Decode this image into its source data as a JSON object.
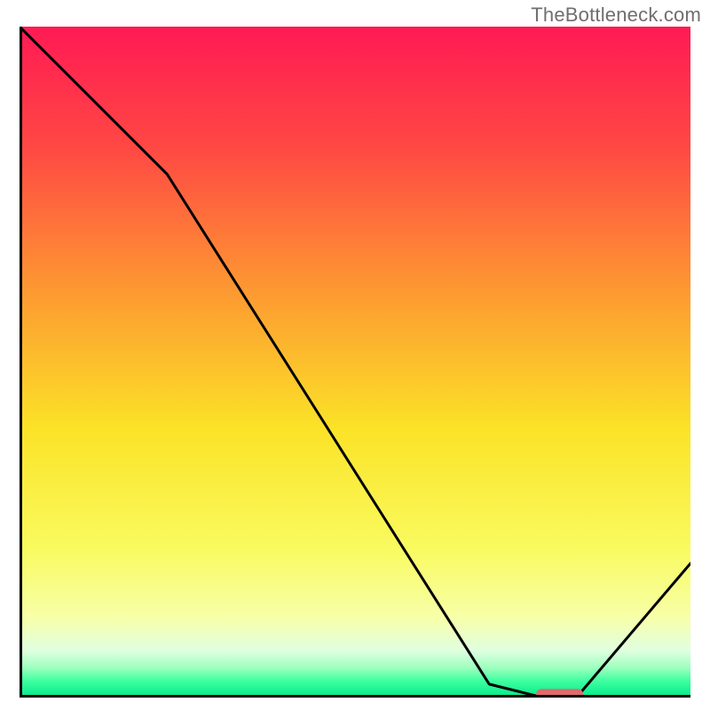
{
  "watermark": "TheBottleneck.com",
  "chart_data": {
    "type": "line",
    "title": "",
    "xlabel": "",
    "ylabel": "",
    "xlim": [
      0,
      100
    ],
    "ylim": [
      0,
      100
    ],
    "x": [
      0,
      22,
      70,
      78,
      83,
      100
    ],
    "values": [
      100,
      78,
      2,
      0,
      0,
      20
    ],
    "marker": {
      "x_start": 77,
      "x_end": 84,
      "y": 0.5,
      "color": "#e06a6c"
    },
    "background_gradient": {
      "stops": [
        {
          "offset": 0.0,
          "color": "#ff1a54"
        },
        {
          "offset": 0.18,
          "color": "#ff4844"
        },
        {
          "offset": 0.4,
          "color": "#fd9b31"
        },
        {
          "offset": 0.6,
          "color": "#fbe327"
        },
        {
          "offset": 0.78,
          "color": "#f9fb60"
        },
        {
          "offset": 0.88,
          "color": "#f8ffa8"
        },
        {
          "offset": 0.93,
          "color": "#e0ffe0"
        },
        {
          "offset": 0.955,
          "color": "#9fffbf"
        },
        {
          "offset": 0.975,
          "color": "#3fffa0"
        },
        {
          "offset": 1.0,
          "color": "#00e98a"
        }
      ]
    },
    "axis_color": "#000000",
    "curve_color": "#000000",
    "curve_width": 3,
    "axis_width": 6
  }
}
